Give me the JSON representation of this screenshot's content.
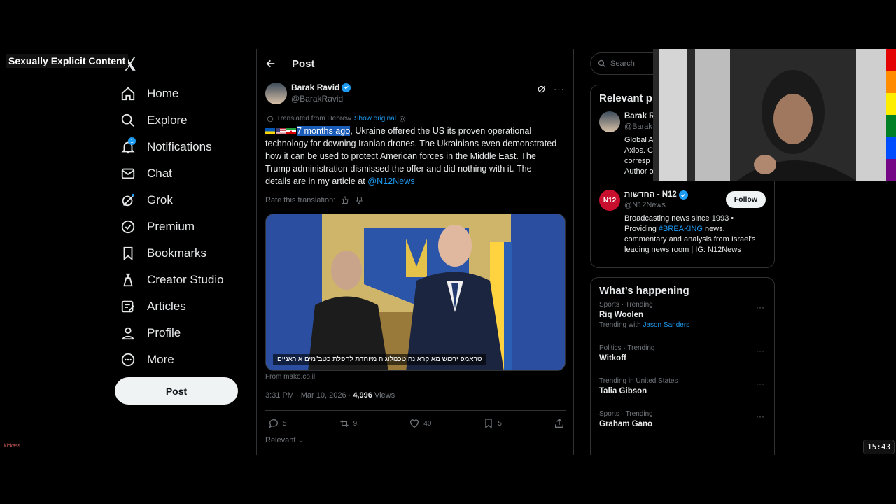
{
  "overlay": {
    "label": "Sexually Explicit Content",
    "watermark": "kickass"
  },
  "nav": {
    "items": [
      {
        "label": "Home",
        "icon": "home-icon"
      },
      {
        "label": "Explore",
        "icon": "search-icon"
      },
      {
        "label": "Notifications",
        "icon": "bell-icon"
      },
      {
        "label": "Chat",
        "icon": "mail-icon"
      },
      {
        "label": "Grok",
        "icon": "grok-icon"
      },
      {
        "label": "Premium",
        "icon": "premium-icon"
      },
      {
        "label": "Bookmarks",
        "icon": "bookmark-icon"
      },
      {
        "label": "Creator Studio",
        "icon": "creator-icon"
      },
      {
        "label": "Articles",
        "icon": "articles-icon"
      },
      {
        "label": "Profile",
        "icon": "profile-icon"
      },
      {
        "label": "More",
        "icon": "more-icon"
      }
    ],
    "notifications_badge": "1",
    "post_label": "Post"
  },
  "main": {
    "header_title": "Post",
    "author": {
      "name": "Barak Ravid",
      "handle": "@BarakRavid"
    },
    "translated_label": "Translated from Hebrew",
    "show_original": "Show original",
    "text_highlight": "7 months ago",
    "text_rest": ", Ukraine offered the US its proven operational technology for downing Iranian drones. The Ukrainians even demonstrated how it can be used to protect American forces in the Middle East. The Trump administration dismissed the offer and did nothing with it. The details are in my article at ",
    "mention": "@N12News",
    "rate_label": "Rate this translation:",
    "media_caption": "טראמפ ירכוש מאוקראינה טכנולוגיה מיוחדת להפלת כטב\"מים איראניים",
    "from": "From mako.co.il",
    "timestamp": "3:31 PM · Mar 10, 2026 · ",
    "views_count": "4,996",
    "views_label": " Views",
    "stats": {
      "replies": "5",
      "reposts": "9",
      "likes": "40",
      "bookmarks": "5"
    },
    "relevant_label": "Relevant"
  },
  "right": {
    "search_placeholder": "Search",
    "relevant_title": "Relevant p",
    "person1": {
      "name": "Barak R",
      "handle": "@Barak",
      "bio": "Global A\nAxios. C\ncorresp\nAuthor o"
    },
    "person2": {
      "name": "החדשות - N12",
      "handle": "@N12News",
      "avatar": "N12",
      "bio_pre": "Broadcasting news since 1993 • Providing ",
      "bio_tag": "#BREAKING",
      "bio_post": " news, commentary and analysis from Israel's leading news room | IG: N12News",
      "follow_label": "Follow"
    },
    "happening_title": "What’s happening",
    "trends": [
      {
        "context": "Sports · Trending",
        "name": "Riq Woolen",
        "with_label": "Trending with ",
        "with": "Jason Sanders"
      },
      {
        "context": "Politics · Trending",
        "name": "Witkoff"
      },
      {
        "context": "Trending in United States",
        "name": "Talia Gibson"
      },
      {
        "context": "Sports · Trending",
        "name": "Graham Gano"
      }
    ]
  },
  "clock": "15:43",
  "colors": {
    "accent": "#1d9bf0",
    "background": "#000000",
    "border": "#2f3336"
  }
}
